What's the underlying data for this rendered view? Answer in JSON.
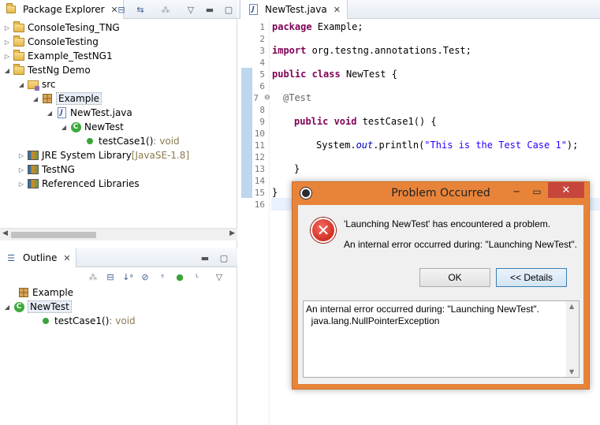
{
  "package_explorer": {
    "title": "Package Explorer",
    "items": [
      {
        "label": "ConsoleTesing_TNG",
        "icon": "project-folder-icon"
      },
      {
        "label": "ConsoleTesting",
        "icon": "project-folder-icon"
      },
      {
        "label": "Example_TestNG1",
        "icon": "project-folder-icon"
      },
      {
        "label": "TestNg Demo",
        "icon": "project-folder-icon"
      },
      {
        "label": "src",
        "icon": "source-folder-icon"
      },
      {
        "label": "Example",
        "icon": "package-icon"
      },
      {
        "label": "NewTest.java",
        "icon": "java-file-icon"
      },
      {
        "label": "NewTest",
        "icon": "class-icon"
      },
      {
        "label": "testCase1()",
        "suffix": " : void",
        "icon": "method-icon"
      },
      {
        "label": "JRE System Library",
        "suffix": " [JavaSE-1.8]",
        "icon": "library-icon"
      },
      {
        "label": "TestNG",
        "icon": "library-icon"
      },
      {
        "label": "Referenced Libraries",
        "icon": "library-icon"
      }
    ]
  },
  "outline": {
    "title": "Outline",
    "items": [
      {
        "label": "Example",
        "icon": "package-icon"
      },
      {
        "label": "NewTest",
        "icon": "class-icon"
      },
      {
        "label": "testCase1()",
        "suffix": " : void",
        "icon": "method-icon"
      }
    ]
  },
  "editor": {
    "tab_title": "NewTest.java",
    "line_numbers": [
      "1",
      "2",
      "3",
      "4",
      "5",
      "6",
      "7",
      "8",
      "9",
      "10",
      "11",
      "12",
      "13",
      "14",
      "15",
      "16"
    ],
    "code": {
      "l1_kw": "package",
      "l1_rest": " Example;",
      "l3_kw": "import",
      "l3_rest": " org.testng.annotations.Test;",
      "l5_kw1": "public",
      "l5_kw2": " class",
      "l5_rest": " NewTest {",
      "l7_ann": "@Test",
      "l9_kw1": "public",
      "l9_kw2": " void",
      "l9_rest": " testCase1() {",
      "l11_pre": "System.",
      "l11_fld": "out",
      "l11_mid": ".println(",
      "l11_str": "\"This is the Test Case 1\"",
      "l11_end": ");",
      "l13": "}",
      "l15": "}"
    }
  },
  "dialog": {
    "title": "Problem Occurred",
    "message": "'Launching NewTest' has encountered a problem.",
    "detail": "An internal error occurred during: \"Launching NewTest\".",
    "ok_label": "OK",
    "details_label": "<< Details",
    "details_line1": "An internal error occurred during: \"Launching NewTest\".",
    "details_line2": "  java.lang.NullPointerException"
  },
  "colors": {
    "dialog_frame": "#e8843a",
    "keyword": "#7f0055",
    "string": "#2a00ff",
    "close_button": "#c7463c"
  }
}
